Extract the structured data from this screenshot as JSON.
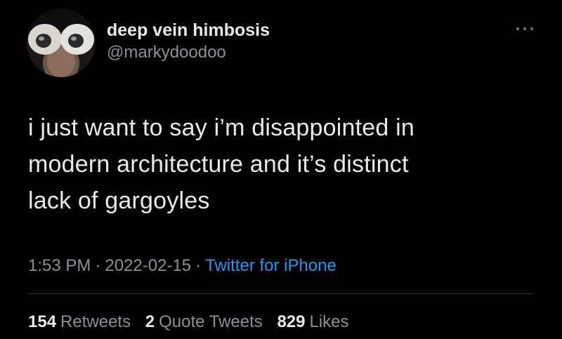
{
  "user": {
    "display_name": "deep vein himbosis",
    "handle": "@markydoodoo"
  },
  "tweet": {
    "text": "i just want to say i’m disappointed in\nmodern architecture and it’s distinct\nlack of gargoyles",
    "time": "1:53 PM",
    "date": "2022-02-15",
    "source": "Twitter for iPhone",
    "separator": "·"
  },
  "stats": {
    "retweets_count": "154",
    "retweets_label": "Retweets",
    "quotes_count": "2",
    "quotes_label": "Quote Tweets",
    "likes_count": "829",
    "likes_label": "Likes"
  },
  "icons": {
    "more": "more-options-icon"
  },
  "colors": {
    "background": "#000000",
    "primary_text": "#e7e9ea",
    "secondary_text": "#8b9096",
    "link": "#1d9bf0",
    "divider": "#2f3336"
  }
}
